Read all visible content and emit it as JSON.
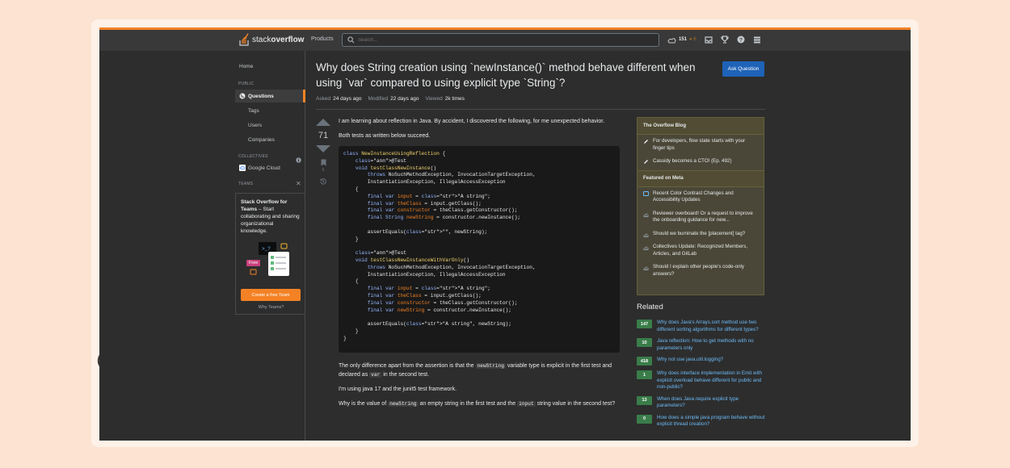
{
  "topbar": {
    "logo_prefix": "stack",
    "logo_suffix": "overflow",
    "products": "Products",
    "search_placeholder": "Search...",
    "reputation": "151",
    "bronze": "● 6"
  },
  "sidebar": {
    "home": "Home",
    "public_head": "PUBLIC",
    "questions": "Questions",
    "tags": "Tags",
    "users": "Users",
    "companies": "Companies",
    "collectives_head": "COLLECTIVES",
    "google_cloud": "Google Cloud",
    "teams_head": "TEAMS",
    "teams_title": "Stack Overflow for Teams",
    "teams_body": " – Start collaborating and sharing organizational knowledge.",
    "free_badge": "Free",
    "teams_button": "Create a free Team",
    "why_teams": "Why Teams?"
  },
  "question": {
    "title": "Why does String creation using `newInstance()` method behave different when using `var` compared to using explicit type `String`?",
    "ask_button": "Ask Question",
    "asked_label": "Asked",
    "asked_value": "24 days ago",
    "modified_label": "Modified",
    "modified_value": "22 days ago",
    "viewed_label": "Viewed",
    "viewed_value": "2k times",
    "votes": "71",
    "bookmarks": "6",
    "p1": "I am learning about reflection in Java. By accident, I discovered the following, for me unexpected behavior.",
    "p2": "Both tests as written below succeed.",
    "p3_a": "The only difference apart from the assertion is that the ",
    "p3_code1": "newString",
    "p3_b": " variable type is explicit in the first test and declared as ",
    "p3_code2": "var",
    "p3_c": " in the second test.",
    "p4": "I'm using java 17 and the junit5 test framework.",
    "p5_a": "Why is the value of ",
    "p5_code1": "newString",
    "p5_b": " an empty string in the first test and the ",
    "p5_code2": "input",
    "p5_c": " string value in the second test?"
  },
  "code_lines": [
    "class NewInstanceUsingReflection {",
    "    @Test",
    "    void testClassNewInstance()",
    "        throws NoSuchMethodException, InvocationTargetException,",
    "        InstantiationException, IllegalAccessException",
    "    {",
    "        final var input = \"A string\";",
    "        final var theClass = input.getClass();",
    "        final var constructor = theClass.getConstructor();",
    "        final String newString = constructor.newInstance();",
    "",
    "        assertEquals(\"\", newString);",
    "    }",
    "",
    "    @Test",
    "    void testClassNewInstanceWithVarOnly()",
    "        throws NoSuchMethodException, InvocationTargetException,",
    "        InstantiationException, IllegalAccessException",
    "    {",
    "        final var input = \"A string\";",
    "        final var theClass = input.getClass();",
    "        final var constructor = theClass.getConstructor();",
    "        final var newString = constructor.newInstance();",
    "",
    "        assertEquals(\"A string\", newString);",
    "    }",
    "}"
  ],
  "blog": {
    "head": "The Overflow Blog",
    "items": [
      "For developers, flow state starts with your finger tips",
      "Cassidy becomes a CTO! (Ep. 492)"
    ],
    "meta_head": "Featured on Meta",
    "meta_items": [
      "Recent Color Contrast Changes and Accessibility Updates",
      "Reviewer overboard! Or a request to improve the onboarding guidance for new...",
      "Should we burninate the [placement] tag?",
      "Collectives Update: Recognized Members, Articles, and GitLab",
      "Should I explain other people's code-only answers?"
    ]
  },
  "related": {
    "title": "Related",
    "items": [
      {
        "score": "147",
        "text": "Why does Java's Arrays.sort method use two different sorting algorithms for different types?"
      },
      {
        "score": "10",
        "text": "Java reflection: How to get methods with no parameters only"
      },
      {
        "score": "418",
        "text": "Why not use java.util.logging?"
      },
      {
        "score": "1",
        "text": "Why does interface implementation in Emit with explicit overload behave different for public and non-public?"
      },
      {
        "score": "13",
        "text": "When does Java require explicit type parameters?"
      },
      {
        "score": "0",
        "text": "How does a simple java program behave without explicit thread creation?"
      }
    ]
  },
  "watermark": "NC",
  "colors": {
    "accent": "#f48225",
    "link": "#6cbbf7",
    "answered": "#3a7d4a",
    "ask_button": "#1e63b8"
  }
}
